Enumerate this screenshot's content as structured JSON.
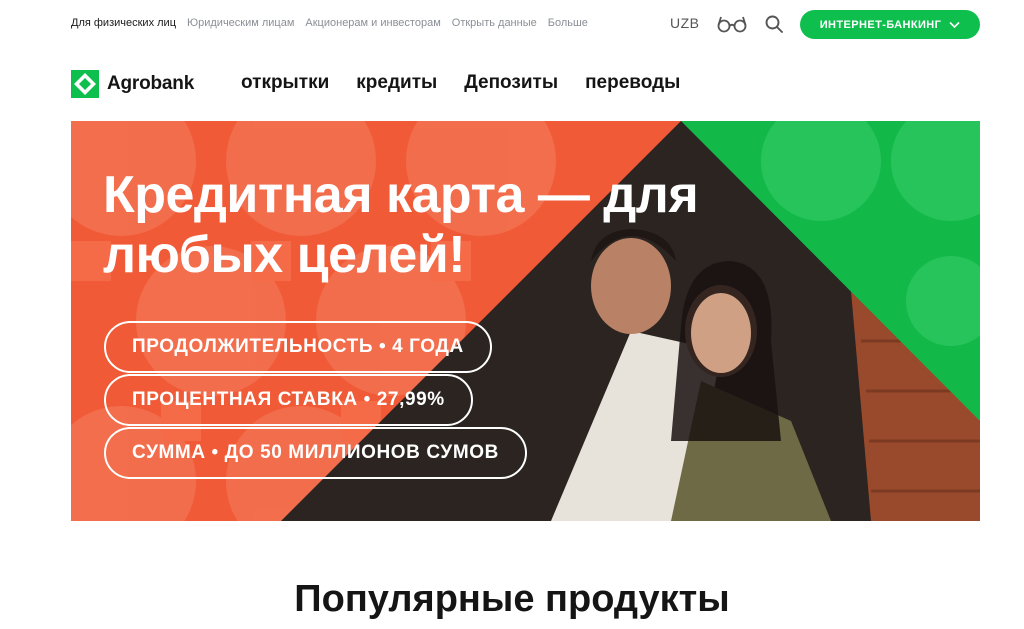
{
  "topbar": {
    "segments": [
      "Для физических лиц",
      "Юридическим лицам",
      "Акционерам и инвесторам",
      "Открыть данные",
      "Больше"
    ],
    "language": "UZB",
    "internet_banking": "ИНТЕРНЕТ-БАНКИНГ"
  },
  "nav": {
    "logo_text": "Agrobank",
    "items": [
      "открытки",
      "кредиты",
      "Депозиты",
      "переводы"
    ]
  },
  "banner": {
    "title": "Кредитная карта — для любых целей!",
    "pills": [
      "ПРОДОЛЖИТЕЛЬНОСТЬ • 4 ГОДА",
      "ПРОЦЕНТНАЯ СТАВКА • 27,99%",
      "СУММА • ДО 50 МИЛЛИОНОВ СУМОВ"
    ]
  },
  "section": {
    "title": "Популярные продукты"
  },
  "colors": {
    "brand_green": "#0fbf4e",
    "banner_orange": "#f15a36",
    "text_dark": "#151515"
  }
}
